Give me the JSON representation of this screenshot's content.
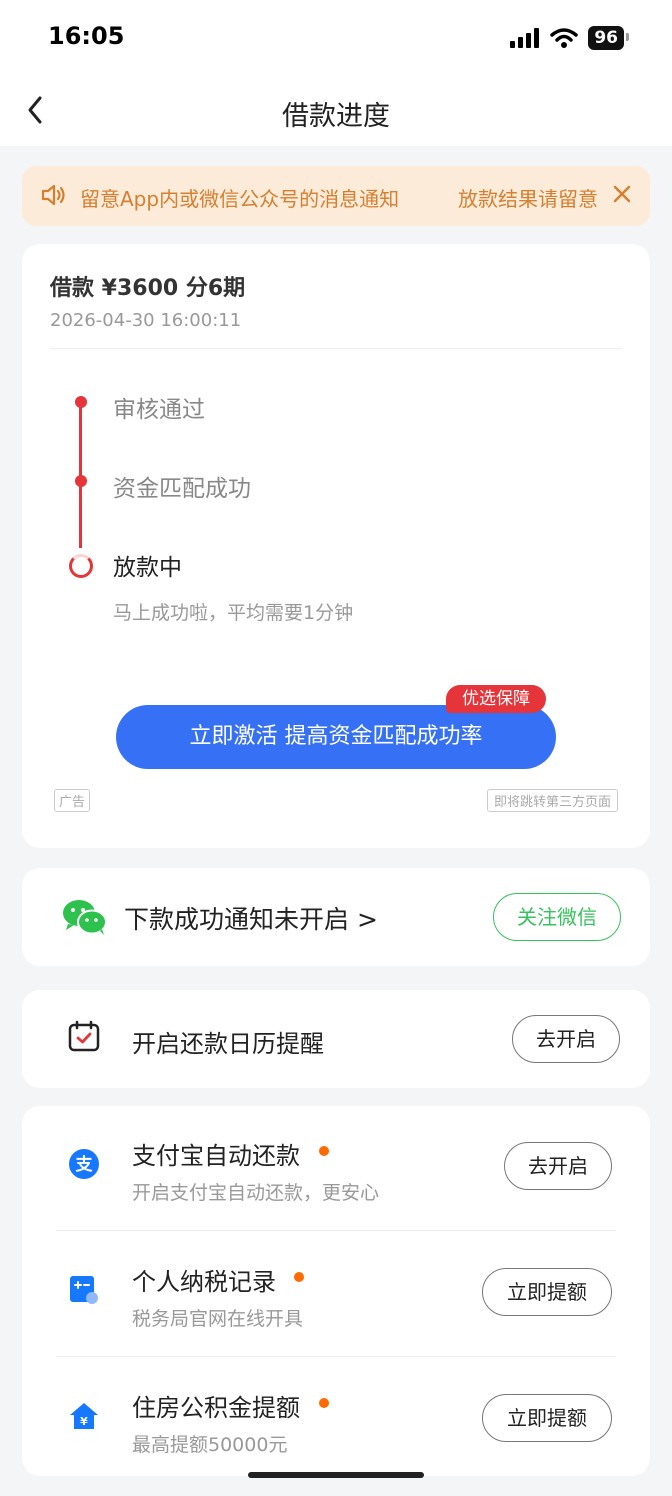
{
  "status_bar": {
    "time": "16:05",
    "battery": "96"
  },
  "nav": {
    "title": "借款进度"
  },
  "notice": {
    "message": "留意App内或微信公众号的消息通知",
    "message_tail": "放款结果请留意"
  },
  "loan": {
    "title": "借款 ¥3600  分6期",
    "time": "2026-04-30 16:00:11",
    "steps": [
      {
        "label": "审核通过"
      },
      {
        "label": "资金匹配成功"
      },
      {
        "label": "放款中",
        "desc": "马上成功啦，平均需要1分钟"
      }
    ],
    "activate_button": "立即激活 提高资金匹配成功率",
    "badge": "优选保障",
    "ad_tag": "广告",
    "jump_tag": "即将跳转第三方页面"
  },
  "wechat": {
    "text": "下款成功通知未开启 >",
    "button": "关注微信"
  },
  "calendar": {
    "text": "开启还款日历提醒",
    "button": "去开启"
  },
  "services": [
    {
      "title": "支付宝自动还款",
      "subtitle": "开启支付宝自动还款，更安心",
      "button": "去开启",
      "icon": "alipay-icon"
    },
    {
      "title": "个人纳税记录",
      "subtitle": "税务局官网在线开具",
      "button": "立即提额",
      "icon": "tax-icon"
    },
    {
      "title": "住房公积金提额",
      "subtitle": "最高提额50000元",
      "button": "立即提额",
      "icon": "housing-fund-icon"
    }
  ],
  "colors": {
    "brand_blue": "#3671f5",
    "progress_red": "#e5343a",
    "wechat_green": "#36c25d",
    "notice_orange": "#d48030",
    "dot_orange": "#ff6a00"
  }
}
